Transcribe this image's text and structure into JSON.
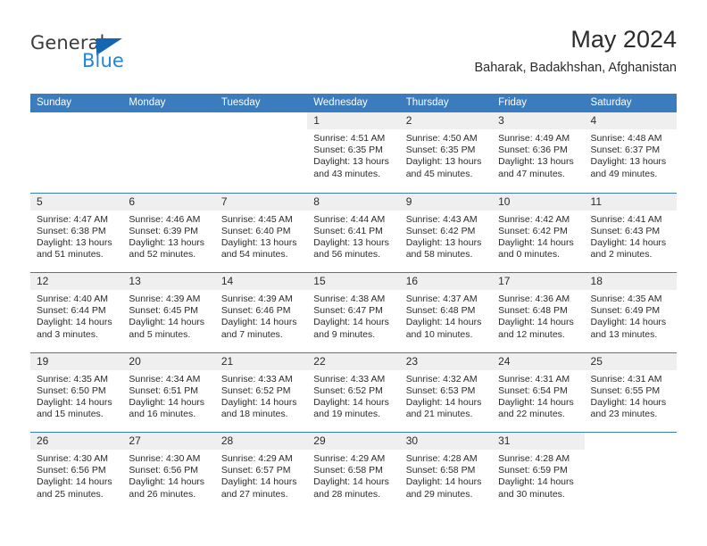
{
  "brand": {
    "name_top": "General",
    "name_bottom": "Blue",
    "triangle_color": "#1565b0",
    "blue_color": "#2585d4"
  },
  "header": {
    "title": "May 2024",
    "subtitle": "Baharak, Badakhshan, Afghanistan"
  },
  "theme": {
    "header_row_bg": "#3a7cbe",
    "week_divider": "#3a7cbe",
    "date_band_bg": "#efefef",
    "text": "#2b2b2b"
  },
  "calendar": {
    "day_headers": [
      "Sunday",
      "Monday",
      "Tuesday",
      "Wednesday",
      "Thursday",
      "Friday",
      "Saturday"
    ],
    "weeks": [
      [
        {
          "day": "",
          "lines": []
        },
        {
          "day": "",
          "lines": []
        },
        {
          "day": "",
          "lines": []
        },
        {
          "day": "1",
          "lines": [
            "Sunrise: 4:51 AM",
            "Sunset: 6:35 PM",
            "Daylight: 13 hours",
            "and 43 minutes."
          ]
        },
        {
          "day": "2",
          "lines": [
            "Sunrise: 4:50 AM",
            "Sunset: 6:35 PM",
            "Daylight: 13 hours",
            "and 45 minutes."
          ]
        },
        {
          "day": "3",
          "lines": [
            "Sunrise: 4:49 AM",
            "Sunset: 6:36 PM",
            "Daylight: 13 hours",
            "and 47 minutes."
          ]
        },
        {
          "day": "4",
          "lines": [
            "Sunrise: 4:48 AM",
            "Sunset: 6:37 PM",
            "Daylight: 13 hours",
            "and 49 minutes."
          ]
        }
      ],
      [
        {
          "day": "5",
          "lines": [
            "Sunrise: 4:47 AM",
            "Sunset: 6:38 PM",
            "Daylight: 13 hours",
            "and 51 minutes."
          ]
        },
        {
          "day": "6",
          "lines": [
            "Sunrise: 4:46 AM",
            "Sunset: 6:39 PM",
            "Daylight: 13 hours",
            "and 52 minutes."
          ]
        },
        {
          "day": "7",
          "lines": [
            "Sunrise: 4:45 AM",
            "Sunset: 6:40 PM",
            "Daylight: 13 hours",
            "and 54 minutes."
          ]
        },
        {
          "day": "8",
          "lines": [
            "Sunrise: 4:44 AM",
            "Sunset: 6:41 PM",
            "Daylight: 13 hours",
            "and 56 minutes."
          ]
        },
        {
          "day": "9",
          "lines": [
            "Sunrise: 4:43 AM",
            "Sunset: 6:42 PM",
            "Daylight: 13 hours",
            "and 58 minutes."
          ]
        },
        {
          "day": "10",
          "lines": [
            "Sunrise: 4:42 AM",
            "Sunset: 6:42 PM",
            "Daylight: 14 hours",
            "and 0 minutes."
          ]
        },
        {
          "day": "11",
          "lines": [
            "Sunrise: 4:41 AM",
            "Sunset: 6:43 PM",
            "Daylight: 14 hours",
            "and 2 minutes."
          ]
        }
      ],
      [
        {
          "day": "12",
          "lines": [
            "Sunrise: 4:40 AM",
            "Sunset: 6:44 PM",
            "Daylight: 14 hours",
            "and 3 minutes."
          ]
        },
        {
          "day": "13",
          "lines": [
            "Sunrise: 4:39 AM",
            "Sunset: 6:45 PM",
            "Daylight: 14 hours",
            "and 5 minutes."
          ]
        },
        {
          "day": "14",
          "lines": [
            "Sunrise: 4:39 AM",
            "Sunset: 6:46 PM",
            "Daylight: 14 hours",
            "and 7 minutes."
          ]
        },
        {
          "day": "15",
          "lines": [
            "Sunrise: 4:38 AM",
            "Sunset: 6:47 PM",
            "Daylight: 14 hours",
            "and 9 minutes."
          ]
        },
        {
          "day": "16",
          "lines": [
            "Sunrise: 4:37 AM",
            "Sunset: 6:48 PM",
            "Daylight: 14 hours",
            "and 10 minutes."
          ]
        },
        {
          "day": "17",
          "lines": [
            "Sunrise: 4:36 AM",
            "Sunset: 6:48 PM",
            "Daylight: 14 hours",
            "and 12 minutes."
          ]
        },
        {
          "day": "18",
          "lines": [
            "Sunrise: 4:35 AM",
            "Sunset: 6:49 PM",
            "Daylight: 14 hours",
            "and 13 minutes."
          ]
        }
      ],
      [
        {
          "day": "19",
          "lines": [
            "Sunrise: 4:35 AM",
            "Sunset: 6:50 PM",
            "Daylight: 14 hours",
            "and 15 minutes."
          ]
        },
        {
          "day": "20",
          "lines": [
            "Sunrise: 4:34 AM",
            "Sunset: 6:51 PM",
            "Daylight: 14 hours",
            "and 16 minutes."
          ]
        },
        {
          "day": "21",
          "lines": [
            "Sunrise: 4:33 AM",
            "Sunset: 6:52 PM",
            "Daylight: 14 hours",
            "and 18 minutes."
          ]
        },
        {
          "day": "22",
          "lines": [
            "Sunrise: 4:33 AM",
            "Sunset: 6:52 PM",
            "Daylight: 14 hours",
            "and 19 minutes."
          ]
        },
        {
          "day": "23",
          "lines": [
            "Sunrise: 4:32 AM",
            "Sunset: 6:53 PM",
            "Daylight: 14 hours",
            "and 21 minutes."
          ]
        },
        {
          "day": "24",
          "lines": [
            "Sunrise: 4:31 AM",
            "Sunset: 6:54 PM",
            "Daylight: 14 hours",
            "and 22 minutes."
          ]
        },
        {
          "day": "25",
          "lines": [
            "Sunrise: 4:31 AM",
            "Sunset: 6:55 PM",
            "Daylight: 14 hours",
            "and 23 minutes."
          ]
        }
      ],
      [
        {
          "day": "26",
          "lines": [
            "Sunrise: 4:30 AM",
            "Sunset: 6:56 PM",
            "Daylight: 14 hours",
            "and 25 minutes."
          ]
        },
        {
          "day": "27",
          "lines": [
            "Sunrise: 4:30 AM",
            "Sunset: 6:56 PM",
            "Daylight: 14 hours",
            "and 26 minutes."
          ]
        },
        {
          "day": "28",
          "lines": [
            "Sunrise: 4:29 AM",
            "Sunset: 6:57 PM",
            "Daylight: 14 hours",
            "and 27 minutes."
          ]
        },
        {
          "day": "29",
          "lines": [
            "Sunrise: 4:29 AM",
            "Sunset: 6:58 PM",
            "Daylight: 14 hours",
            "and 28 minutes."
          ]
        },
        {
          "day": "30",
          "lines": [
            "Sunrise: 4:28 AM",
            "Sunset: 6:58 PM",
            "Daylight: 14 hours",
            "and 29 minutes."
          ]
        },
        {
          "day": "31",
          "lines": [
            "Sunrise: 4:28 AM",
            "Sunset: 6:59 PM",
            "Daylight: 14 hours",
            "and 30 minutes."
          ]
        },
        {
          "day": "",
          "lines": []
        }
      ]
    ]
  }
}
